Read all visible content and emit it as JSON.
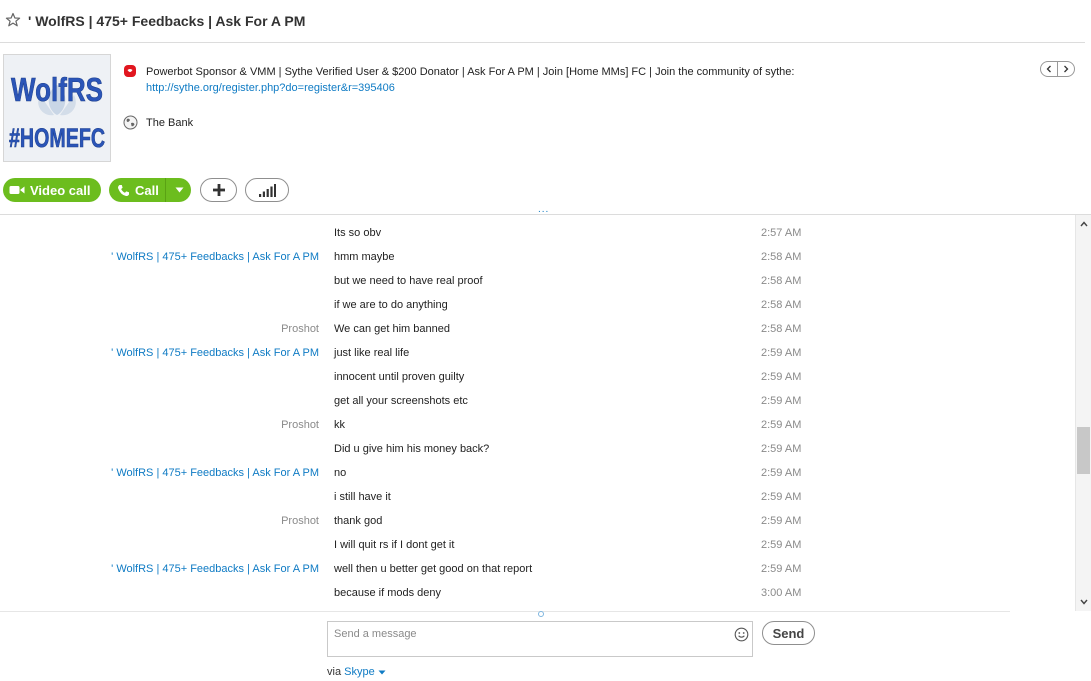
{
  "header": {
    "title": "' WolfRS | 475+ Feedbacks | Ask For A PM"
  },
  "profile": {
    "avatar_line1": "WolfRS",
    "avatar_line2": "#HOMEFC",
    "mood": "Powerbot Sponsor & VMM | Sythe Verified User & $200 Donator |  Ask For A PM  |  Join [Home MMs] FC | Join the community of sythe:",
    "mood_link": "http://sythe.org/register.php?do=register&r=395406",
    "location": "The Bank"
  },
  "actions": {
    "video_call": "Video call",
    "call": "Call"
  },
  "chat": {
    "loading_indicator": "...",
    "messages": [
      {
        "sender": "",
        "sender_type": "me",
        "text": "Its so obv",
        "time": "2:57 AM"
      },
      {
        "sender": "' WolfRS | 475+ Feedbacks | Ask For A PM",
        "sender_type": "me",
        "text": "hmm maybe",
        "time": "2:58 AM"
      },
      {
        "sender": "",
        "sender_type": "me",
        "text": "but we need to have real proof",
        "time": "2:58 AM"
      },
      {
        "sender": "",
        "sender_type": "me",
        "text": "if we are to do anything",
        "time": "2:58 AM"
      },
      {
        "sender": "Proshot",
        "sender_type": "other",
        "text": "We can get him banned",
        "time": "2:58 AM"
      },
      {
        "sender": "' WolfRS | 475+ Feedbacks | Ask For A PM",
        "sender_type": "me",
        "text": "just like real life",
        "time": "2:59 AM"
      },
      {
        "sender": "",
        "sender_type": "me",
        "text": "innocent until proven guilty",
        "time": "2:59 AM"
      },
      {
        "sender": "",
        "sender_type": "me",
        "text": "get all your screenshots etc",
        "time": "2:59 AM"
      },
      {
        "sender": "Proshot",
        "sender_type": "other",
        "text": "kk",
        "time": "2:59 AM"
      },
      {
        "sender": "",
        "sender_type": "other",
        "text": "Did u give him his money back?",
        "time": "2:59 AM"
      },
      {
        "sender": "' WolfRS | 475+ Feedbacks | Ask For A PM",
        "sender_type": "me",
        "text": "no",
        "time": "2:59 AM"
      },
      {
        "sender": "",
        "sender_type": "me",
        "text": "i still have it",
        "time": "2:59 AM"
      },
      {
        "sender": "Proshot",
        "sender_type": "other",
        "text": "thank god",
        "time": "2:59 AM"
      },
      {
        "sender": "",
        "sender_type": "other",
        "text": "I will quit rs if I dont get it",
        "time": "2:59 AM"
      },
      {
        "sender": "' WolfRS | 475+ Feedbacks | Ask For A PM",
        "sender_type": "me",
        "text": "well then u better get good on that report",
        "time": "2:59 AM"
      },
      {
        "sender": "",
        "sender_type": "me",
        "text": "because if mods deny",
        "time": "3:00 AM"
      }
    ]
  },
  "compose": {
    "placeholder": "Send a message",
    "send_label": "Send",
    "via_prefix": "via",
    "via_service": "Skype"
  },
  "colors": {
    "accent_green": "#6cbd1e",
    "link_blue": "#0f7bc4",
    "sender_gray": "#8a8a8a"
  },
  "icons": {
    "favorite": "star-icon",
    "mood": "skype-mood-icon",
    "location": "globe-icon",
    "video": "video-camera-icon",
    "call": "phone-icon",
    "add": "plus-icon",
    "quality": "signal-bars-icon",
    "emoticon": "smiley-icon"
  }
}
